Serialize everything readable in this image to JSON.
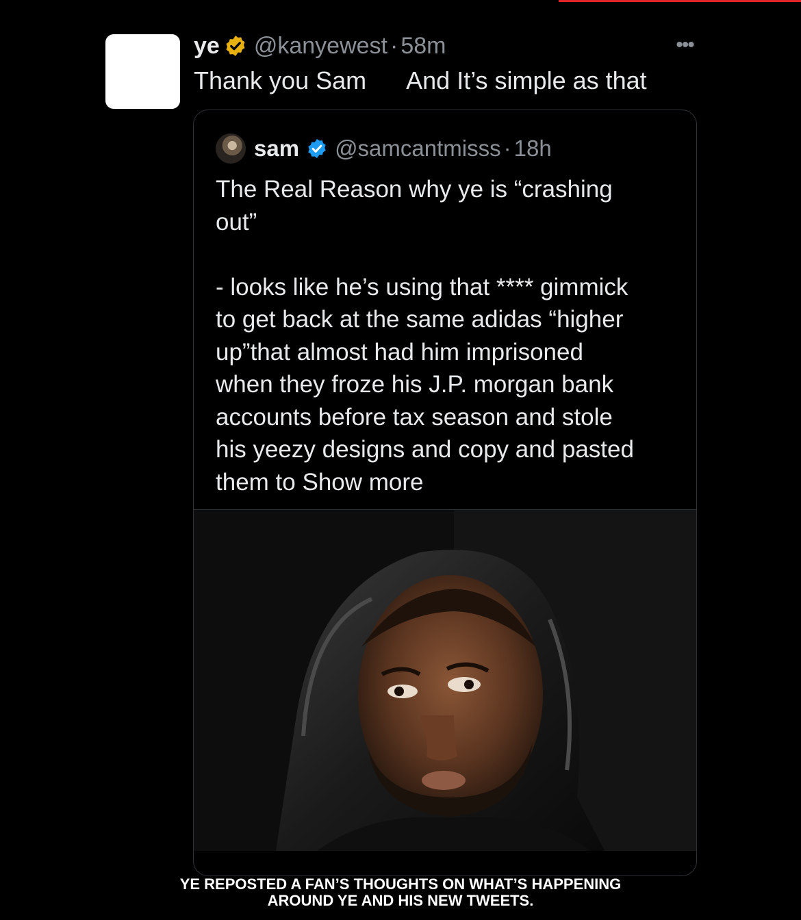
{
  "tweet": {
    "display_name": "ye",
    "handle": "@kanyewest",
    "separator": "·",
    "time": "58m",
    "text": "Thank you Sam      And It’s simple as that",
    "badge_icon": "verified-gold-badge-icon",
    "more_icon": "more-options-icon",
    "more_label": "•••"
  },
  "quoted_tweet": {
    "display_name": "sam",
    "handle": "@samcantmisss",
    "separator": "·",
    "time": "18h",
    "badge_icon": "verified-blue-badge-icon",
    "text_lines": [
      "The Real Reason why ye is “crashing",
      "out”",
      "",
      "- looks like he’s using that **** gimmick",
      "to get back at the same adidas “higher",
      "up”that almost had him imprisoned",
      "when they froze his J.P. morgan bank",
      "accounts before tax season and stole",
      "his yeezy designs and copy and pasted"
    ],
    "last_line_text": "them to",
    "show_more": "Show more"
  },
  "caption": {
    "line1": "YE REPOSTED A FAN’S THOUGHTS ON WHAT’S HAPPENING",
    "line2": "AROUND YE AND HIS NEW TWEETS."
  },
  "colors": {
    "background": "#000000",
    "text": "#e7e9ea",
    "secondary_text": "#8b9097",
    "gold_badge": "#e8b10f",
    "blue_badge": "#1d9bf0",
    "border": "#2f3336",
    "accent_bar": "#e0242e"
  }
}
